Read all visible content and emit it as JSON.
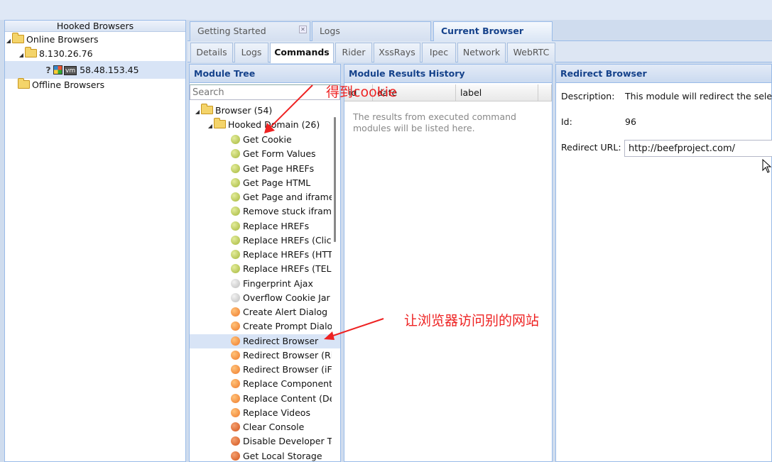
{
  "left_panel": {
    "title": "Hooked Browsers",
    "online": "Online Browsers",
    "ip_group": "8.130.26.76",
    "hooked_ip": "58.48.153.45",
    "unknown_mark": "?",
    "vm_mark": "vm",
    "offline": "Offline Browsers"
  },
  "main_tabs": [
    {
      "label": "Getting Started",
      "closable": true
    },
    {
      "label": "Logs"
    },
    {
      "label": "Current Browser",
      "active": true
    }
  ],
  "close_glyph": "✕",
  "sub_tabs": [
    "Details",
    "Logs",
    "Commands",
    "Rider",
    "XssRays",
    "Ipec",
    "Network",
    "WebRTC"
  ],
  "active_sub_tab": "Commands",
  "module_tree": {
    "title": "Module Tree",
    "search_placeholder": "Search",
    "root": "Browser (54)",
    "subfolder": "Hooked Domain (26)",
    "modules": [
      {
        "label": "Get Cookie",
        "status": "green"
      },
      {
        "label": "Get Form Values",
        "status": "green"
      },
      {
        "label": "Get Page HREFs",
        "status": "green"
      },
      {
        "label": "Get Page HTML",
        "status": "green"
      },
      {
        "label": "Get Page and iframe HTML",
        "status": "green"
      },
      {
        "label": "Remove stuck iframes",
        "status": "green"
      },
      {
        "label": "Replace HREFs",
        "status": "green"
      },
      {
        "label": "Replace HREFs (Click Events)",
        "status": "green"
      },
      {
        "label": "Replace HREFs (HTTPS)",
        "status": "green"
      },
      {
        "label": "Replace HREFs (TEL)",
        "status": "green"
      },
      {
        "label": "Fingerprint Ajax",
        "status": "grey"
      },
      {
        "label": "Overflow Cookie Jar",
        "status": "grey"
      },
      {
        "label": "Create Alert Dialog",
        "status": "orange"
      },
      {
        "label": "Create Prompt Dialog",
        "status": "orange"
      },
      {
        "label": "Redirect Browser",
        "status": "orange",
        "selected": true
      },
      {
        "label": "Redirect Browser (Rickroll)",
        "status": "orange"
      },
      {
        "label": "Redirect Browser (iFrame)",
        "status": "orange"
      },
      {
        "label": "Replace Component (Deface)",
        "status": "orange"
      },
      {
        "label": "Replace Content (Deface)",
        "status": "orange"
      },
      {
        "label": "Replace Videos",
        "status": "orange"
      },
      {
        "label": "Clear Console",
        "status": "red"
      },
      {
        "label": "Disable Developer Tools",
        "status": "red"
      },
      {
        "label": "Get Local Storage",
        "status": "red"
      }
    ]
  },
  "results": {
    "title": "Module Results History",
    "columns": [
      "id",
      "date",
      "label"
    ],
    "empty_text": "The results from executed command modules will be listed here."
  },
  "detail": {
    "title": "Redirect Browser",
    "description_label": "Description:",
    "description_value": "This module will redirect the selected",
    "id_label": "Id:",
    "id_value": "96",
    "url_label": "Redirect URL:",
    "url_value": "http://beefproject.com/"
  },
  "annotations": {
    "cookie_note": "得到cookie",
    "redirect_note": "让浏览器访问别的网站",
    "color": "#ee2222"
  }
}
